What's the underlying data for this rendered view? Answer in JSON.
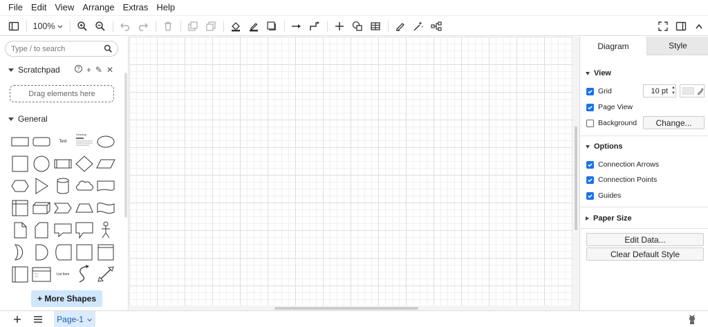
{
  "menu": [
    "File",
    "Edit",
    "View",
    "Arrange",
    "Extras",
    "Help"
  ],
  "toolbar": {
    "zoom": "100%"
  },
  "sidebar": {
    "search_placeholder": "Type / to search",
    "scratchpad_title": "Scratchpad",
    "scratchpad_icons": [
      "?",
      "+",
      "✎",
      "✕"
    ],
    "dropzone_text": "Drag elements here",
    "general_title": "General",
    "shape_text_label": "Text",
    "shape_heading_label": "Heading",
    "shape_list_label": "List Item",
    "more_shapes": "+ More Shapes"
  },
  "panel": {
    "tabs": [
      "Diagram",
      "Style"
    ],
    "view_title": "View",
    "grid_label": "Grid",
    "grid_size": "10 pt",
    "page_view_label": "Page View",
    "background_label": "Background",
    "change_button": "Change...",
    "options_title": "Options",
    "connection_arrows": "Connection Arrows",
    "connection_points": "Connection Points",
    "guides": "Guides",
    "paper_size_title": "Paper Size",
    "edit_data": "Edit Data...",
    "clear_default_style": "Clear Default Style",
    "checks": {
      "grid": true,
      "page_view": true,
      "background": false,
      "connection_arrows": true,
      "connection_points": true,
      "guides": true
    }
  },
  "bottom": {
    "page_tab": "Page-1"
  },
  "colors": {
    "accent": "#1a73e8",
    "more_shapes_bg": "#cfe6fc",
    "page_tab_bg": "#dbeafc"
  }
}
